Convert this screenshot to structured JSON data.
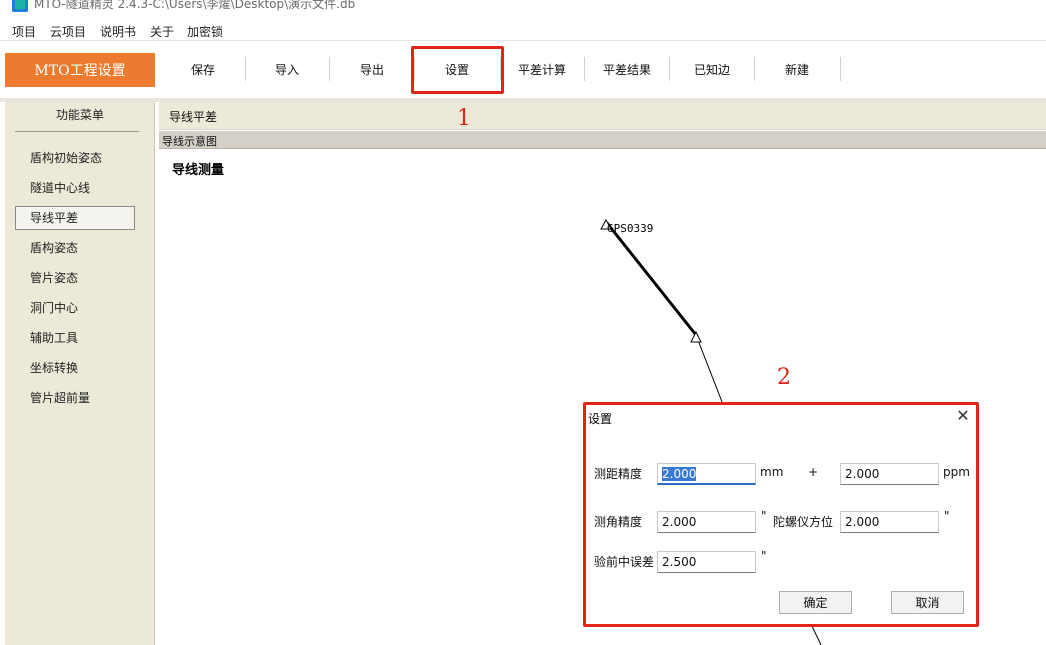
{
  "window": {
    "title": "MTO-隧道精灵 2.4.3-C:\\Users\\李燿\\Desktop\\演示文件.db"
  },
  "menu": [
    "项目",
    "云项目",
    "说明书",
    "关于",
    "加密锁"
  ],
  "toolbar": {
    "brand": "MTO工程设置",
    "buttons": [
      "保存",
      "导入",
      "导出",
      "设置",
      "平差计算",
      "平差结果",
      "已知边",
      "新建"
    ]
  },
  "sidebar": {
    "title": "功能菜单",
    "items": [
      "盾构初始姿态",
      "隧道中心线",
      "导线平差",
      "盾构姿态",
      "管片姿态",
      "洞门中心",
      "辅助工具",
      "坐标转换",
      "管片超前量"
    ],
    "active_index": 2
  },
  "main": {
    "tab": "导线平差",
    "schematic_label": "导线示意图",
    "canvas_title": "导线测量",
    "station_label": "GPS0339"
  },
  "annotations": [
    "1",
    "2"
  ],
  "dialog": {
    "title": "设置",
    "close": "✕",
    "distance_label": "测距精度",
    "distance_value": "2.000",
    "distance_unit": "mm",
    "plus": "+",
    "distance_ppm_value": "2.000",
    "ppm_unit": "ppm",
    "angle_label": "测角精度",
    "angle_value": "2.000",
    "angle_unit": "\"",
    "gyro_label": "陀螺仪方位",
    "gyro_value": "2.000",
    "gyro_unit": "\"",
    "prior_label": "验前中误差",
    "prior_value": "2.500",
    "prior_unit": "\"",
    "ok": "确定",
    "cancel": "取消"
  },
  "colors": {
    "brand": "#ec7a2f",
    "highlight": "#e2231a",
    "sidebar_bg": "#ece9d8"
  }
}
